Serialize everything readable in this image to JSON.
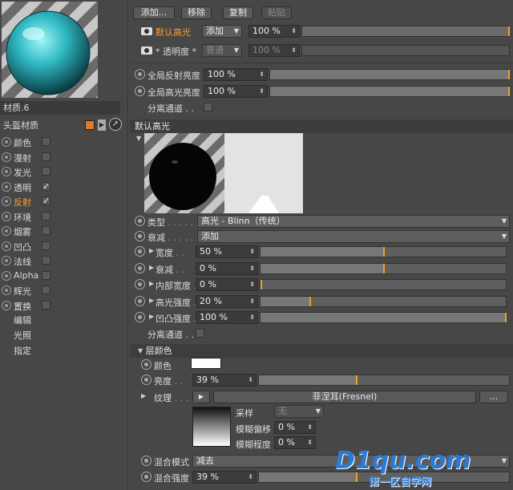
{
  "material": {
    "name": "材质.6",
    "type_label": "头盔材质",
    "channels": [
      {
        "label": "颜色",
        "checked": false,
        "active": false
      },
      {
        "label": "漫射",
        "checked": false,
        "active": false
      },
      {
        "label": "发光",
        "checked": false,
        "active": false
      },
      {
        "label": "透明",
        "checked": true,
        "active": false
      },
      {
        "label": "反射",
        "checked": true,
        "active": true
      },
      {
        "label": "环境",
        "checked": false,
        "active": false
      },
      {
        "label": "烟雾",
        "checked": false,
        "active": false
      },
      {
        "label": "凹凸",
        "checked": false,
        "active": false
      },
      {
        "label": "法线",
        "checked": false,
        "active": false
      },
      {
        "label": "Alpha",
        "checked": false,
        "active": false
      },
      {
        "label": "辉光",
        "checked": false,
        "active": false
      },
      {
        "label": "置换",
        "checked": false,
        "active": false
      }
    ],
    "extra_links": [
      "编辑",
      "光照",
      "指定"
    ]
  },
  "toolbar": {
    "add": "添加...",
    "remove": "移除",
    "copy": "复制",
    "paste": "粘贴"
  },
  "layers": [
    {
      "name": "默认高光",
      "mode": "添加",
      "value": "100 %",
      "active": true
    },
    {
      "name": "* 透明度 *",
      "mode": "普通",
      "value": "100 %",
      "active": false
    }
  ],
  "global": {
    "reflect_label": "全局反射亮度",
    "reflect_value": "100 %",
    "specular_label": "全局高光亮度",
    "specular_value": "100 %",
    "separate_label": "分离通道 . ."
  },
  "layer_section": {
    "title": "默认高光",
    "type_label": "类型",
    "type_value": "高光 - Blinn（传统）",
    "attenuation_label": "衰减",
    "attenuation_value": "添加",
    "rows": [
      {
        "label": "宽度",
        "value": "50 %",
        "level": 0.5
      },
      {
        "label": "衰减",
        "value": "0 %",
        "level": 0.5
      },
      {
        "label": "内部宽度",
        "value": "0 %",
        "level": 0.0
      },
      {
        "label": "高光强度",
        "value": "20 %",
        "level": 0.2
      },
      {
        "label": "凹凸强度",
        "value": "100 %",
        "level": 1.0
      }
    ],
    "separate_label": "分离通道 . ."
  },
  "layer_color": {
    "title": "层颜色",
    "color_label": "颜色",
    "color_value": "#ffffff",
    "brightness_label": "亮度",
    "brightness_value": "39 %",
    "brightness_level": 0.39,
    "texture_label": "纹理",
    "texture_value": "菲涅耳(Fresnel)",
    "texture_more": "...",
    "sampling_label": "采样",
    "sampling_value": "无",
    "blur_offset_label": "模糊偏移",
    "blur_offset_value": "0 %",
    "blur_degree_label": "模糊程度",
    "blur_degree_value": "0 %",
    "blend_mode_label": "混合模式",
    "blend_mode_value": "减去",
    "blend_strength_label": "混合强度",
    "blend_strength_value": "39 %",
    "blend_strength_level": 0.39
  },
  "watermark": {
    "brand": "D1qu.com",
    "sub": "第一区自学网"
  }
}
